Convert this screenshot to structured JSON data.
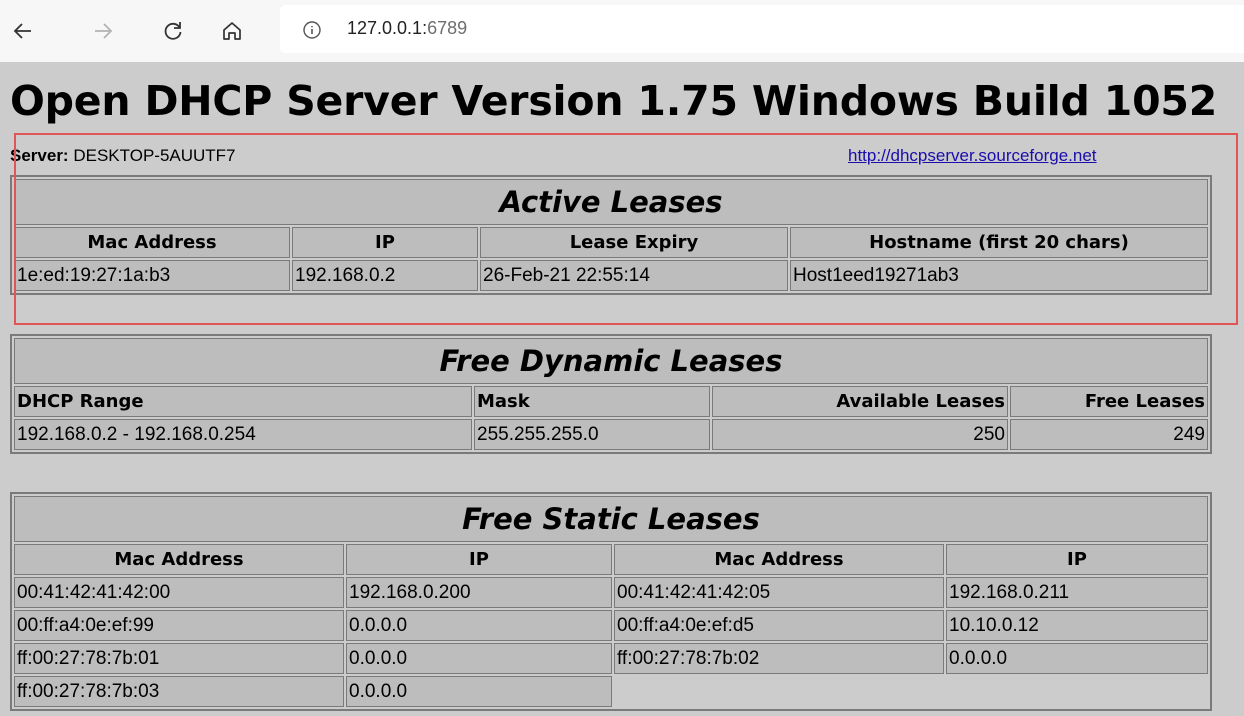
{
  "browser": {
    "url_host": "127.0.0.1:",
    "url_port": "6789",
    "icons": [
      "back-icon",
      "forward-icon",
      "reload-icon",
      "home-icon",
      "info-icon"
    ]
  },
  "page": {
    "title": "Open DHCP Server Version 1.75 Windows Build 1052",
    "server_label": "Server:",
    "server_name": "DESKTOP-5AUUTF7",
    "link": "http://dhcpserver.sourceforge.net"
  },
  "active": {
    "title": "Active Leases",
    "headers": [
      "Mac Address",
      "IP",
      "Lease Expiry",
      "Hostname (first 20 chars)"
    ],
    "rows": [
      [
        "1e:ed:19:27:1a:b3",
        "192.168.0.2",
        "26-Feb-21 22:55:14",
        "Host1eed19271ab3"
      ]
    ]
  },
  "dynamic": {
    "title": "Free Dynamic Leases",
    "headers": [
      "DHCP Range",
      "Mask",
      "Available Leases",
      "Free Leases"
    ],
    "rows": [
      [
        "192.168.0.2 - 192.168.0.254",
        "255.255.255.0",
        "250",
        "249"
      ]
    ]
  },
  "static": {
    "title": "Free Static Leases",
    "headers": [
      "Mac Address",
      "IP",
      "Mac Address",
      "IP"
    ],
    "rows": [
      [
        "00:41:42:41:42:00",
        "192.168.0.200",
        "00:41:42:41:42:05",
        "192.168.0.211"
      ],
      [
        "00:ff:a4:0e:ef:99",
        "0.0.0.0",
        "00:ff:a4:0e:ef:d5",
        "10.10.0.12"
      ],
      [
        "ff:00:27:78:7b:01",
        "0.0.0.0",
        "ff:00:27:78:7b:02",
        "0.0.0.0"
      ],
      [
        "ff:00:27:78:7b:03",
        "0.0.0.0",
        "",
        ""
      ]
    ]
  }
}
